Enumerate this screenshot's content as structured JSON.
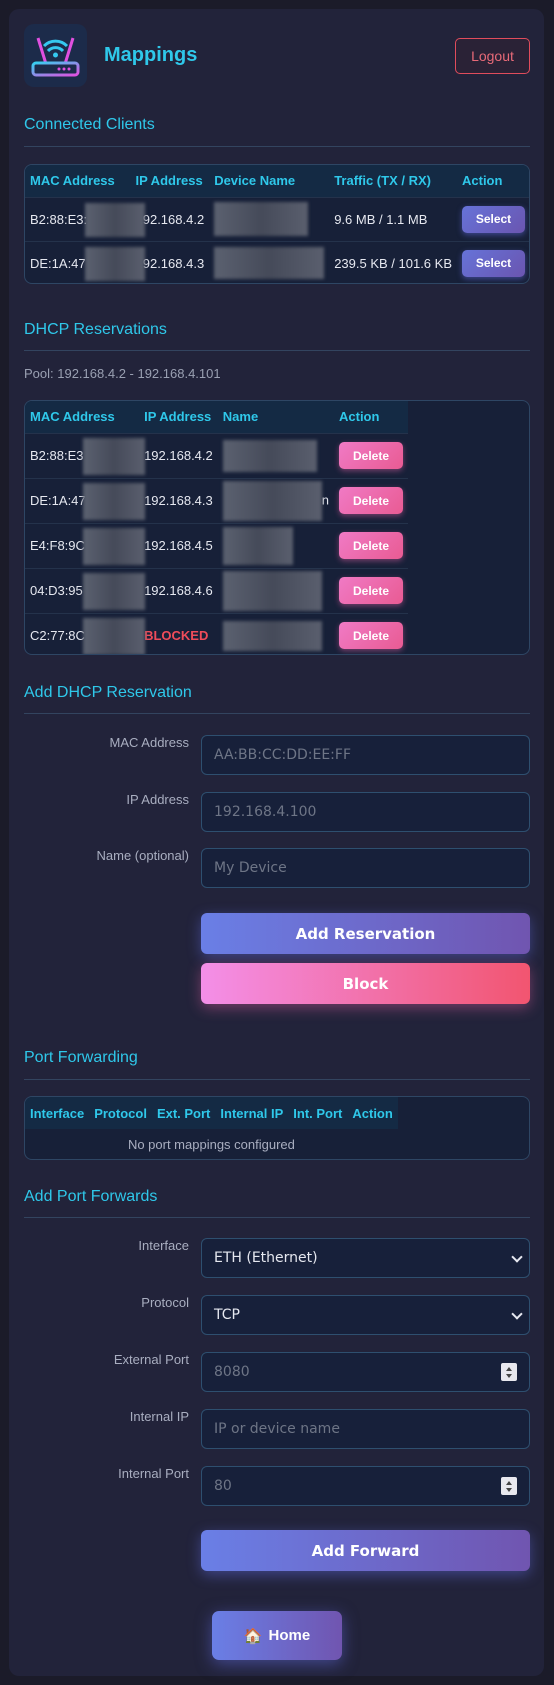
{
  "header": {
    "title": "Mappings",
    "logout_label": "Logout",
    "logo_icon": "router-wifi-icon"
  },
  "clients": {
    "title": "Connected Clients",
    "columns": [
      "MAC Address",
      "IP Address",
      "Device Name",
      "Traffic (TX / RX)",
      "Action"
    ],
    "rows": [
      {
        "mac": "B2:88:E3:",
        "ip": "192.168.4.2",
        "name": "",
        "traffic": "9.6 MB / 1.1 MB",
        "action": "Select"
      },
      {
        "mac": "DE:1A:47",
        "ip": "192.168.4.3",
        "name": "",
        "traffic": "239.5 KB / 101.6 KB",
        "action": "Select"
      }
    ]
  },
  "reservations": {
    "title": "DHCP Reservations",
    "pool": "Pool: 192.168.4.2 - 192.168.4.101",
    "columns": [
      "MAC Address",
      "IP Address",
      "Name",
      "Action"
    ],
    "rows": [
      {
        "mac": "B2:88:E3",
        "ip": "192.168.4.2",
        "name": "",
        "action": "Delete"
      },
      {
        "mac": "DE:1A:47",
        "ip": "192.168.4.3",
        "name": "n",
        "action": "Delete"
      },
      {
        "mac": "E4:F8:9C",
        "ip": "192.168.4.5",
        "name": "",
        "action": "Delete"
      },
      {
        "mac": "04:D3:95",
        "ip": "192.168.4.6",
        "name": "",
        "action": "Delete"
      },
      {
        "mac": "C2:77:8C",
        "ip": "BLOCKED",
        "name": "",
        "action": "Delete"
      }
    ]
  },
  "add_reservation": {
    "title": "Add DHCP Reservation",
    "mac_label": "MAC Address",
    "mac_placeholder": "AA:BB:CC:DD:EE:FF",
    "ip_label": "IP Address",
    "ip_placeholder": "192.168.4.100",
    "name_label": "Name (optional)",
    "name_placeholder": "My Device",
    "add_label": "Add Reservation",
    "block_label": "Block"
  },
  "port_forwarding": {
    "title": "Port Forwarding",
    "columns": [
      "Interface",
      "Protocol",
      "Ext. Port",
      "Internal IP",
      "Int. Port",
      "Action"
    ],
    "empty": "No port mappings configured"
  },
  "add_forward": {
    "title": "Add Port Forwards",
    "interface_label": "Interface",
    "interface_value": "ETH (Ethernet)",
    "protocol_label": "Protocol",
    "protocol_value": "TCP",
    "ext_port_label": "External Port",
    "ext_port_placeholder": "8080",
    "internal_ip_label": "Internal IP",
    "internal_ip_placeholder": "IP or device name",
    "int_port_label": "Internal Port",
    "int_port_placeholder": "80",
    "submit_label": "Add Forward"
  },
  "footer": {
    "home_label": "Home",
    "home_icon": "house-icon"
  },
  "colors": {
    "accent": "#2fc8ea",
    "background": "#1b1b29",
    "danger": "#e04c5c"
  }
}
